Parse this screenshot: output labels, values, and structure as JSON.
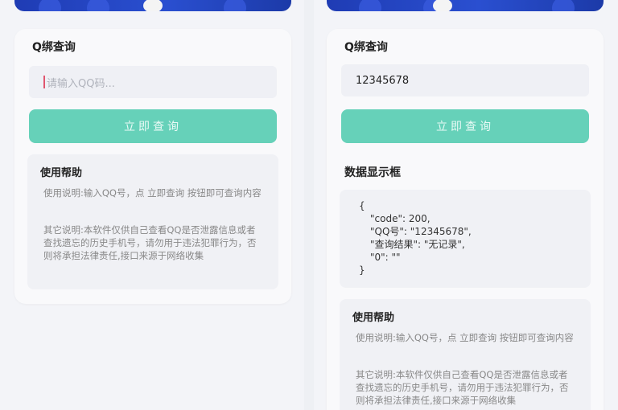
{
  "left": {
    "title": "Q绑查询",
    "input_placeholder": "请输入QQ码...",
    "button_label": "立即查询",
    "help": {
      "title": "使用帮助",
      "usage": "使用说明:输入QQ号，点 立即查询 按钮即可查询内容",
      "other": "其它说明:本软件仅供自己查看QQ是否泄露信息或者查找遗忘的历史手机号，请勿用于违法犯罪行为，否则将承担法律责任,接口来源于网络收集"
    }
  },
  "right": {
    "title": "Q绑查询",
    "input_value": "12345678",
    "button_label": "立即查询",
    "result_title": "数据显示框",
    "result_lines": [
      "{",
      "\"code\": 200,",
      "\"QQ号\": \"12345678\",",
      "\"查询结果\": \"无记录\",",
      "\"0\": \"\"",
      "}"
    ],
    "help": {
      "title": "使用帮助",
      "usage": "使用说明:输入QQ号，点 立即查询 按钮即可查询内容",
      "other": "其它说明:本软件仅供自己查看QQ是否泄露信息或者查找遗忘的历史手机号，请勿用于违法犯罪行为，否则将承担法律责任,接口来源于网络收集"
    }
  }
}
